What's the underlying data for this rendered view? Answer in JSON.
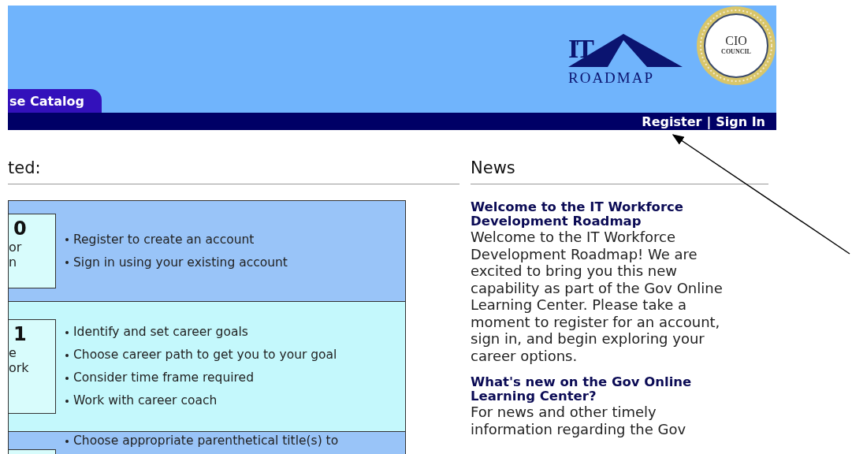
{
  "header": {
    "logo": {
      "mark": "IT",
      "name": "ROADMAP"
    },
    "seal": {
      "line1": "CIO",
      "line2": "COUNCIL"
    },
    "tabs": [
      {
        "label": "se Catalog",
        "selected": true
      }
    ],
    "account_links": [
      {
        "label": "Register"
      },
      {
        "label": "Sign In"
      }
    ],
    "separator": "|"
  },
  "steps_section": {
    "title": "ted:",
    "steps": [
      {
        "number": "0",
        "card_lines": [
          "or",
          "n"
        ],
        "bullets": [
          "Register to create an account",
          "Sign in using your existing account"
        ]
      },
      {
        "number": "1",
        "card_lines": [
          "e",
          "ork"
        ],
        "bullets": [
          "Identify and set career goals",
          "Choose career path to get you to your goal",
          "Consider time frame required",
          "Work with career coach"
        ]
      },
      {
        "bullets": [
          "Choose appropriate parenthetical title(s) to"
        ]
      }
    ]
  },
  "news": {
    "title": "News",
    "items": [
      {
        "headline": "Welcome to the IT Workforce Development Roadmap",
        "body": "Welcome to the IT Workforce Development Roadmap! We are excited to bring you this new capability as part of the Gov Online Learning Center. Please take a moment to register for an account, sign in, and begin exploring your career options."
      },
      {
        "headline": "What's new on the Gov Online Learning Center?",
        "body": "For news and other timely information regarding the Gov"
      }
    ]
  }
}
